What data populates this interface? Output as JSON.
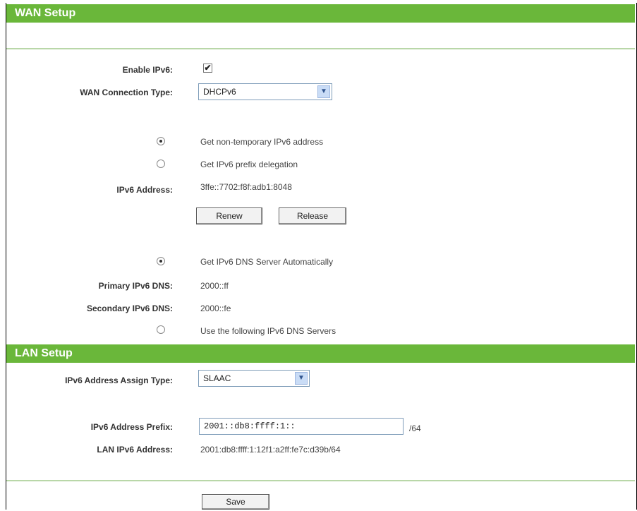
{
  "wan": {
    "header": "WAN Setup",
    "enable_ipv6_label": "Enable IPv6:",
    "enable_ipv6_mark": "✔",
    "connection_type_label": "WAN Connection Type:",
    "connection_type_value": "DHCPv6",
    "option_nontemp": "Get non-temporary IPv6 address",
    "option_prefix": "Get IPv6 prefix delegation",
    "ipv6_address_label": "IPv6 Address:",
    "ipv6_address_value": "3ffe::7702:f8f:adb1:8048",
    "renew_label": "Renew",
    "release_label": "Release",
    "dns_auto_label": "Get IPv6 DNS Server Automatically",
    "primary_dns_label": "Primary IPv6 DNS:",
    "primary_dns_value": "2000::ff",
    "secondary_dns_label": "Secondary IPv6 DNS:",
    "secondary_dns_value": "2000::fe",
    "dns_manual_label": "Use the following IPv6 DNS Servers"
  },
  "lan": {
    "header": "LAN Setup",
    "assign_type_label": "IPv6 Address Assign Type:",
    "assign_type_value": "SLAAC",
    "prefix_label": "IPv6 Address Prefix:",
    "prefix_value": "2001::db8:ffff:1::",
    "prefix_suffix": "/64",
    "lan_address_label": "LAN IPv6 Address:",
    "lan_address_value": "2001:db8:ffff:1:12f1:a2ff:fe7c:d39b/64"
  },
  "save_label": "Save"
}
